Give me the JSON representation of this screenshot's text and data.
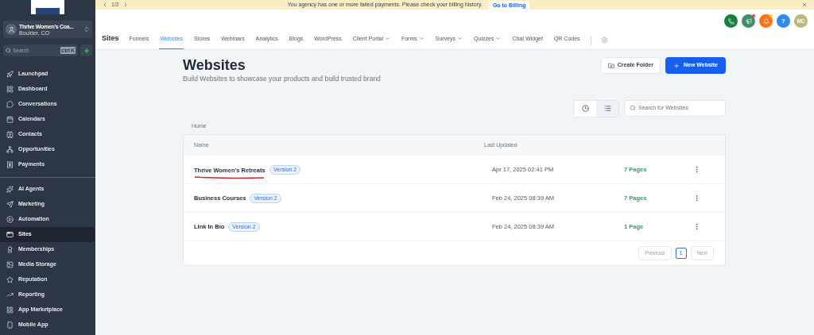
{
  "banner": {
    "pager": "1/2",
    "message": "You agency has one or more failed payments. Please check your billing history.",
    "action": "Go to Billing"
  },
  "account": {
    "name": "Thrive Women's Coa...",
    "location": "Boulder, CO"
  },
  "search": {
    "placeholder": "Search",
    "shortcut_keys": [
      "ctrl",
      "K"
    ]
  },
  "sidebar": {
    "groups": [
      {
        "items": [
          {
            "label": "Launchpad",
            "selected": false
          },
          {
            "label": "Dashboard",
            "selected": false
          },
          {
            "label": "Conversations",
            "selected": false
          },
          {
            "label": "Calendars",
            "selected": false
          },
          {
            "label": "Contacts",
            "selected": false
          },
          {
            "label": "Opportunities",
            "selected": false
          },
          {
            "label": "Payments",
            "selected": false
          }
        ]
      },
      {
        "items": [
          {
            "label": "AI Agents",
            "selected": false
          },
          {
            "label": "Marketing",
            "selected": false
          },
          {
            "label": "Automation",
            "selected": false
          },
          {
            "label": "Sites",
            "selected": true
          },
          {
            "label": "Memberships",
            "selected": false
          },
          {
            "label": "Media Storage",
            "selected": false
          },
          {
            "label": "Reputation",
            "selected": false
          },
          {
            "label": "Reporting",
            "selected": false
          },
          {
            "label": "App Marketplace",
            "selected": false
          },
          {
            "label": "Mobile App",
            "selected": false
          }
        ]
      }
    ]
  },
  "header_actions": [
    {
      "kind": "phone",
      "color": "#15803d",
      "badge": false
    },
    {
      "kind": "megaphone",
      "color": "#3f8f6a",
      "badge": true
    },
    {
      "kind": "bell",
      "color": "#f97316",
      "badge": true
    },
    {
      "kind": "help",
      "color": "#2e8bf0",
      "badge": false,
      "label": "?"
    },
    {
      "kind": "avatar",
      "color": "#bdb77a",
      "badge": false,
      "initials": "MC"
    }
  ],
  "section_title": "Sites",
  "tabs": [
    {
      "label": "Funnels",
      "selected": false,
      "dropdown": false
    },
    {
      "label": "Websites",
      "selected": true,
      "dropdown": false
    },
    {
      "label": "Stores",
      "selected": false,
      "dropdown": false
    },
    {
      "label": "Webinars",
      "selected": false,
      "dropdown": false
    },
    {
      "label": "Analytics",
      "selected": false,
      "dropdown": false
    },
    {
      "label": "Blogs",
      "selected": false,
      "dropdown": false
    },
    {
      "label": "WordPress",
      "selected": false,
      "dropdown": false
    },
    {
      "label": "Client Portal",
      "selected": false,
      "dropdown": true
    },
    {
      "label": "Forms",
      "selected": false,
      "dropdown": true
    },
    {
      "label": "Surveys",
      "selected": false,
      "dropdown": true
    },
    {
      "label": "Quizzes",
      "selected": false,
      "dropdown": true
    },
    {
      "label": "Chat Widget",
      "selected": false,
      "dropdown": false
    },
    {
      "label": "QR Codes",
      "selected": false,
      "dropdown": false
    }
  ],
  "page": {
    "title": "Websites",
    "subtitle": "Build Websites to showcase your products and build trusted brand",
    "create_folder": "Create Folder",
    "new_website": "New Website"
  },
  "view_toggle": [
    {
      "kind": "recent",
      "selected": false
    },
    {
      "kind": "list",
      "selected": true
    }
  ],
  "search_websites": {
    "placeholder": "Search for Websites"
  },
  "breadcrumb": "Home",
  "table": {
    "columns": [
      "Name",
      "Last Updated"
    ],
    "rows": [
      {
        "name": "Thrive Women's Retreats",
        "version": "Version 2",
        "updated": "Apr 17, 2025 02:41 PM",
        "pages": "7 Pages",
        "underlined": true
      },
      {
        "name": "Business Courses",
        "version": "Version 2",
        "updated": "Feb 24, 2025 08:39 AM",
        "pages": "7 Pages",
        "underlined": false
      },
      {
        "name": "Link In Bio",
        "version": "Version 2",
        "updated": "Feb 24, 2025 08:39 AM",
        "pages": "1 Page",
        "underlined": false
      }
    ]
  },
  "pagination": {
    "previous": "Previous",
    "pages": [
      {
        "label": "1",
        "selected": true
      }
    ],
    "next": "Next",
    "previous_disabled": true,
    "next_disabled": true
  }
}
